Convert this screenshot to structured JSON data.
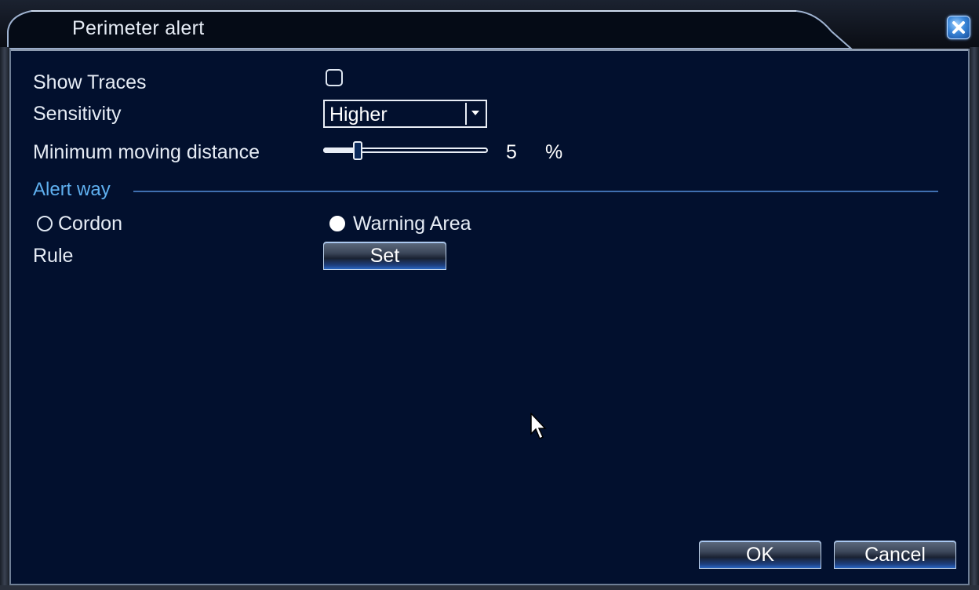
{
  "window": {
    "title": "Perimeter alert",
    "close_icon": "close-icon"
  },
  "form": {
    "show_traces": {
      "label": "Show Traces",
      "checked": false
    },
    "sensitivity": {
      "label": "Sensitivity",
      "value": "Higher"
    },
    "min_distance": {
      "label": "Minimum moving distance",
      "value": "5",
      "unit": "%",
      "fraction": 0.05
    },
    "alert_way": {
      "title": "Alert way",
      "options": [
        {
          "label": "Cordon",
          "selected": false
        },
        {
          "label": "Warning Area",
          "selected": true
        }
      ]
    },
    "rule": {
      "label": "Rule",
      "button": "Set"
    }
  },
  "footer": {
    "ok": "OK",
    "cancel": "Cancel"
  },
  "colors": {
    "background": "#02102e",
    "section_accent": "#5fb0f0",
    "text": "#e6ecf5"
  }
}
